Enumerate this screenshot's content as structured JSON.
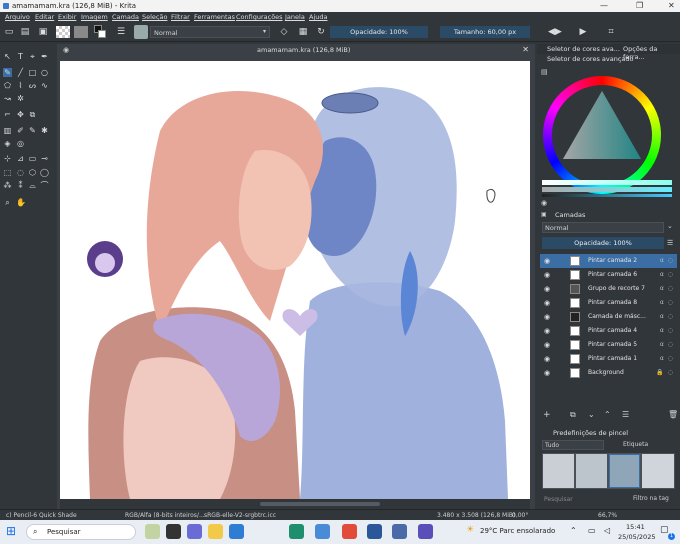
{
  "window": {
    "title": "amamamam.kra (126,8 MiB) - Krita"
  },
  "menu": [
    "Arquivo",
    "Editar",
    "Exibir",
    "Imagem",
    "Camada",
    "Seleção",
    "Filtrar",
    "Ferramentas",
    "Configurações",
    "Janela",
    "Ajuda"
  ],
  "toolbar": {
    "blend_mode": "Normal",
    "opacity_label": "Opacidade: 100%",
    "size_label": "Tamanho: 60,00 px"
  },
  "document": {
    "tab_title": "amamamam.kra (126,8 MiB)"
  },
  "docker_tabs": {
    "color_tab": "Seletor de cores ava...",
    "tool_options_tab": "Opções da ferra..."
  },
  "color_selector": {
    "title": "Seletor de cores avançado"
  },
  "layers_panel": {
    "title": "Camadas",
    "blend_mode": "Normal",
    "opacity_label": "Opacidade:  100%",
    "layers": [
      {
        "name": "Pintar camada 2",
        "selected": true
      },
      {
        "name": "Pintar camada 6",
        "selected": false
      },
      {
        "name": "Grupo de recorte 7",
        "selected": false
      },
      {
        "name": "Pintar camada 8",
        "selected": false
      },
      {
        "name": "Camada de másc...",
        "selected": false
      },
      {
        "name": "Pintar camada 4",
        "selected": false
      },
      {
        "name": "Pintar camada 5",
        "selected": false
      },
      {
        "name": "Pintar camada 1",
        "selected": false
      },
      {
        "name": "Background",
        "selected": false
      }
    ]
  },
  "brush_presets": {
    "title": "Predefinições de pincel",
    "filter_all": "Tudo",
    "tag_label": "Etiqueta",
    "search_placeholder": "Pesquisar",
    "filter_by_tag": "Filtro na tag"
  },
  "status": {
    "brush": "c) Pencil-6 Quick Shade",
    "color_space": "RGB/Alfa (8-bits inteiros/...",
    "profile": "sRGB-elle-V2-srgbtrc.icc",
    "dimensions": "3.480 x 3.508 (126,8 MiB)",
    "rotation": "0,00°",
    "zoom": "66,7%"
  },
  "taskbar": {
    "search_placeholder": "Pesquisar",
    "weather": "29°C  Parc ensolarado",
    "time": "15:41",
    "date": "25/05/2025",
    "notification_count": "1"
  },
  "colors": {
    "skin": "#e7b7a8",
    "hair_warm": "#e7a89a",
    "blue_figure": "#7e95cc",
    "lilac": "#b8a6d8",
    "chibi_purple": "#5a3e8c"
  }
}
